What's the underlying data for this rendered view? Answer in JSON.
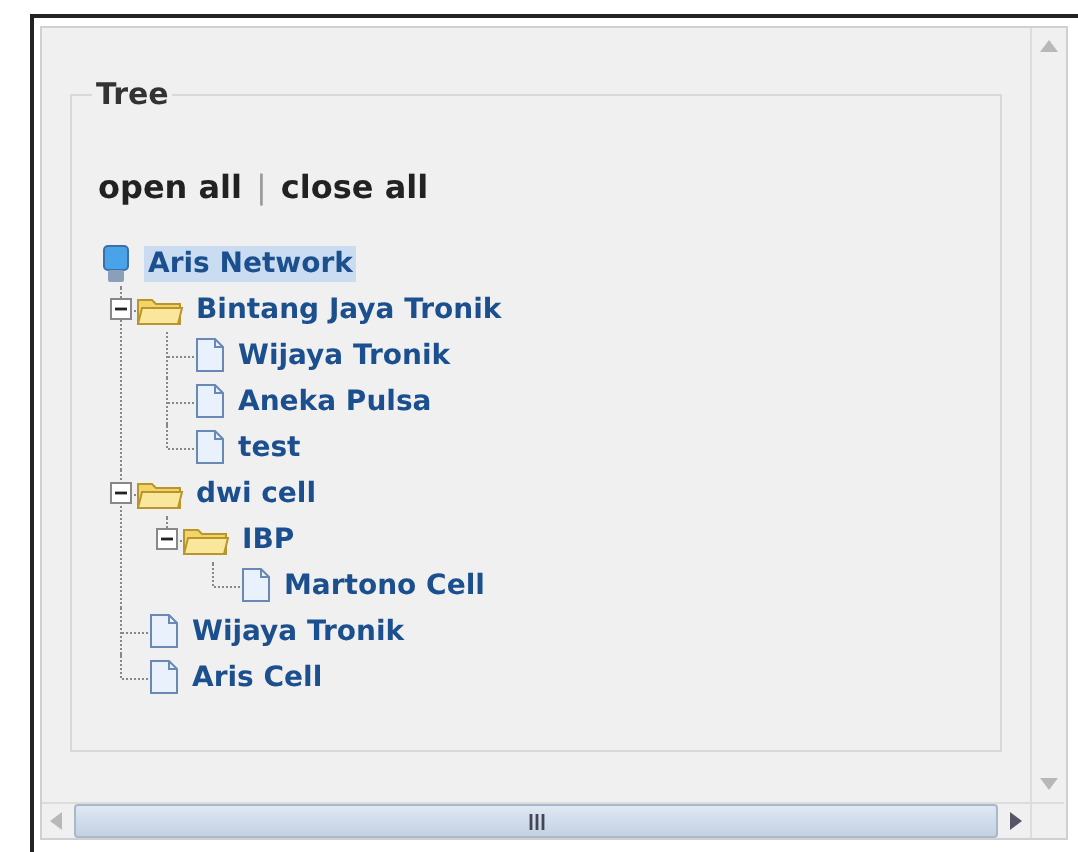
{
  "panel": {
    "legend": "Tree",
    "actions": {
      "open_all": "open all",
      "separator": "|",
      "close_all": "close all"
    },
    "tree": [
      {
        "label": "Aris Network",
        "kind": "root",
        "selected": true,
        "children": [
          {
            "label": "Bintang Jaya Tronik",
            "kind": "folder",
            "selected": false,
            "expanded": true,
            "children": [
              {
                "label": "Wijaya Tronik",
                "kind": "leaf",
                "selected": false
              },
              {
                "label": "Aneka Pulsa",
                "kind": "leaf",
                "selected": false
              },
              {
                "label": "test",
                "kind": "leaf",
                "selected": false
              }
            ]
          },
          {
            "label": "dwi cell",
            "kind": "folder",
            "selected": false,
            "expanded": true,
            "children": [
              {
                "label": "IBP",
                "kind": "folder",
                "selected": false,
                "expanded": true,
                "children": [
                  {
                    "label": "Martono Cell",
                    "kind": "leaf",
                    "selected": false
                  }
                ]
              }
            ]
          },
          {
            "label": "Wijaya Tronik",
            "kind": "leaf",
            "selected": false
          },
          {
            "label": "Aris Cell",
            "kind": "leaf",
            "selected": false
          }
        ]
      }
    ]
  }
}
